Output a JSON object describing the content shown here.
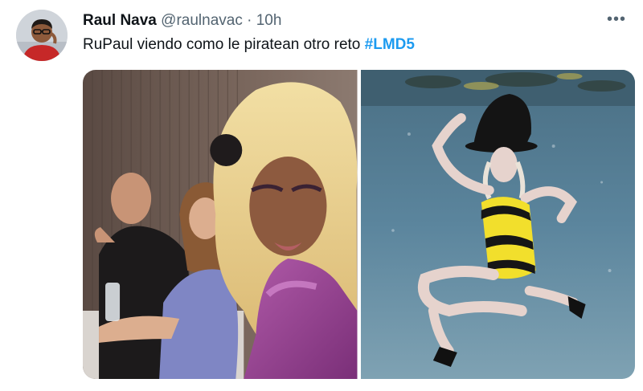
{
  "tweet": {
    "author_name": "Raul Nava",
    "handle": "@raulnavac",
    "separator": "·",
    "time": "10h",
    "text_before": "RuPaul viendo como le piratean otro reto ",
    "hashtag": "#LMD5",
    "more_icon": "more-horizontal-icon"
  },
  "colors": {
    "link": "#1d9bf0",
    "text": "#0f1419",
    "secondary": "#536471"
  }
}
